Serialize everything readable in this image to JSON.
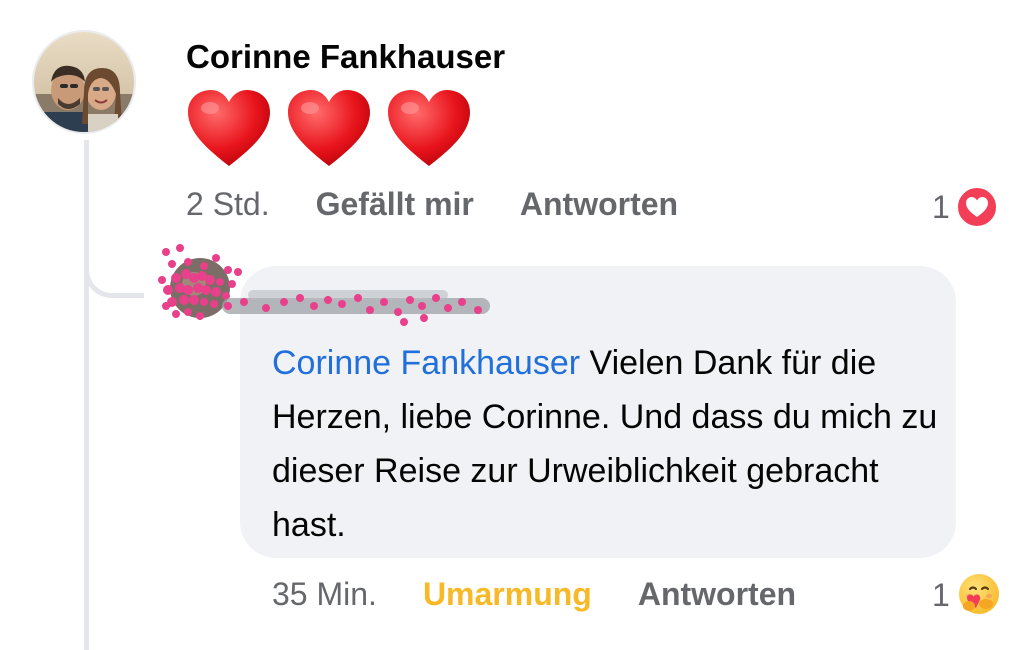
{
  "comment": {
    "author": "Corinne Fankhauser",
    "content_emoji": [
      "heart-emoji",
      "heart-emoji",
      "heart-emoji"
    ],
    "time": "2 Std.",
    "like_label": "Gefällt mir",
    "reply_label": "Antworten",
    "reaction_count": "1",
    "reaction_type": "love-reaction-icon"
  },
  "reply": {
    "author_redacted": true,
    "mention": "Corinne Fankhauser",
    "text": " Vielen Dank für die Herzen, liebe Corinne. Und dass du mich zu dieser Reise zur Urweiblichkeit gebracht hast.",
    "time": "35 Min.",
    "reaction_label": "Umarmung",
    "reply_label": "Antworten",
    "reaction_count": "1",
    "reaction_type": "care-hug-reaction-icon"
  },
  "colors": {
    "mention": "#216fdb",
    "hug": "#f7b928",
    "meta": "#65676b",
    "bubble": "#f0f2f5",
    "love": "#f33e58"
  }
}
